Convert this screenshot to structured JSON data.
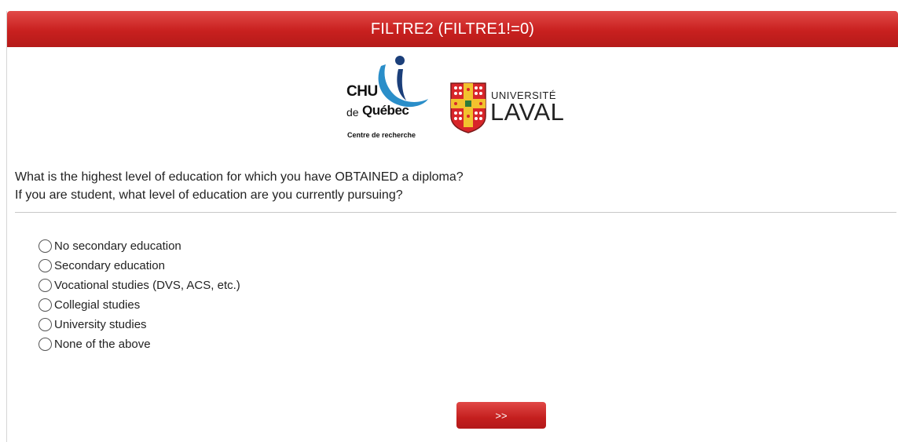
{
  "header": {
    "title": "FILTRE2 (FILTRE1!=0)"
  },
  "logos": {
    "chu": {
      "line1": "CHU",
      "de": "de",
      "quebec": "Québec",
      "subtitle": "Centre de recherche",
      "color_blue": "#2a8ec9",
      "color_navy": "#1b3f7a"
    },
    "laval": {
      "line1": "UNIVERSITÉ",
      "line2": "LAVAL",
      "shield_red": "#d8262a",
      "shield_gold": "#f2c22e"
    }
  },
  "question": {
    "line1": "What is the highest level of education for which you have OBTAINED a diploma?",
    "line2": "If you are student, what level of education are you currently pursuing?"
  },
  "options": [
    {
      "label": "No secondary education"
    },
    {
      "label": "Secondary education"
    },
    {
      "label": "Vocational studies (DVS, ACS, etc.)"
    },
    {
      "label": "Collegial studies"
    },
    {
      "label": "University studies"
    },
    {
      "label": "None of the above"
    }
  ],
  "navigation": {
    "next_label": ">>"
  },
  "colors": {
    "accent": "#c8201f",
    "header_text": "#ffffff"
  }
}
